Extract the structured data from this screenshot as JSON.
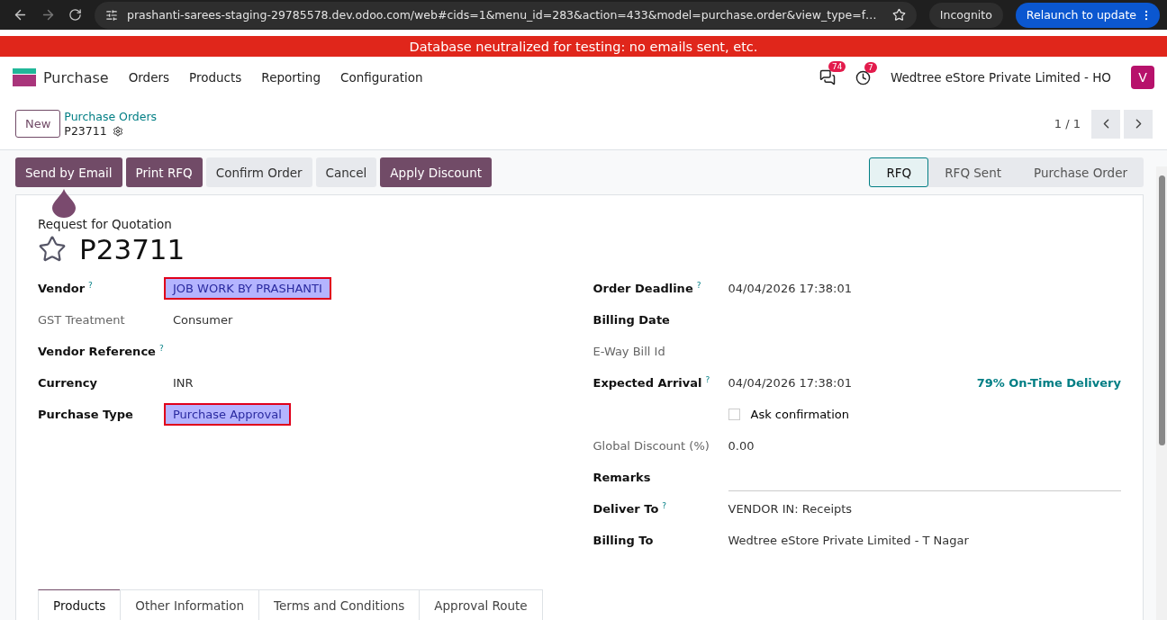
{
  "browser": {
    "url": "prashanti-sarees-staging-29785578.dev.odoo.com/web#cids=1&menu_id=283&action=433&model=purchase.order&view_type=f…",
    "profile": "Incognito",
    "update_button": "Relaunch to update"
  },
  "banner": "Database neutralized for testing: no emails sent, etc.",
  "navbar": {
    "app": "Purchase",
    "menus": [
      "Orders",
      "Products",
      "Reporting",
      "Configuration"
    ],
    "messages_count": "74",
    "activities_count": "7",
    "company": "Wedtree eStore Private Limited - HO",
    "avatar": "V"
  },
  "breadcrumb": {
    "new_button": "New",
    "parent": "Purchase Orders",
    "current": "P23711"
  },
  "pager": "1 / 1",
  "actions": [
    {
      "label": "Send by Email",
      "primary": true
    },
    {
      "label": "Print RFQ",
      "primary": true
    },
    {
      "label": "Confirm Order",
      "primary": false
    },
    {
      "label": "Cancel",
      "primary": false
    },
    {
      "label": "Apply Discount",
      "primary": true
    }
  ],
  "statusbar": [
    {
      "label": "RFQ",
      "selected": true
    },
    {
      "label": "RFQ Sent",
      "selected": false
    },
    {
      "label": "Purchase Order",
      "selected": false
    }
  ],
  "form": {
    "subtitle": "Request for Quotation",
    "title": "P23711",
    "starred": false,
    "left_fields": [
      {
        "label": "Vendor",
        "help": "?",
        "muted": false,
        "value": "JOB WORK BY PRASHANTI",
        "highlighted": true
      },
      {
        "label": "GST Treatment",
        "muted": true,
        "value": "Consumer",
        "highlighted": false
      },
      {
        "label": "Vendor Reference",
        "help": "?",
        "muted": false
      },
      {
        "label": "Currency",
        "muted": false,
        "value": "INR",
        "highlighted": false
      },
      {
        "label": "Purchase Type",
        "muted": false,
        "value": "Purchase Approval",
        "highlighted": true
      }
    ],
    "right_fields": [
      {
        "kind": "field",
        "label": "Order Deadline",
        "help": "?",
        "muted": false,
        "value": "04/04/2026 17:38:01"
      },
      {
        "kind": "field",
        "label": "Billing Date",
        "muted": false
      },
      {
        "kind": "field",
        "label": "E-Way Bill Id",
        "muted": true
      },
      {
        "kind": "field",
        "label": "Expected Arrival",
        "help": "?",
        "muted": false,
        "value": "04/04/2026 17:38:01",
        "extra": "79% On-Time Delivery"
      },
      {
        "kind": "checkbox",
        "value": "Ask confirmation",
        "checked": false
      },
      {
        "kind": "field",
        "label": "Global Discount (%)",
        "muted": true,
        "value": "0.00"
      },
      {
        "kind": "textline",
        "label": "Remarks",
        "muted": false
      },
      {
        "kind": "field",
        "label": "Deliver To",
        "help": "?",
        "muted": false,
        "value": "VENDOR IN: Receipts"
      },
      {
        "kind": "field",
        "label": "Billing To",
        "muted": false,
        "value": "Wedtree eStore Private Limited - T Nagar"
      }
    ],
    "tabs": [
      {
        "label": "Products",
        "selected": true
      },
      {
        "label": "Other Information",
        "selected": false
      },
      {
        "label": "Terms and Conditions",
        "selected": false
      },
      {
        "label": "Approval Route",
        "selected": false
      }
    ]
  }
}
